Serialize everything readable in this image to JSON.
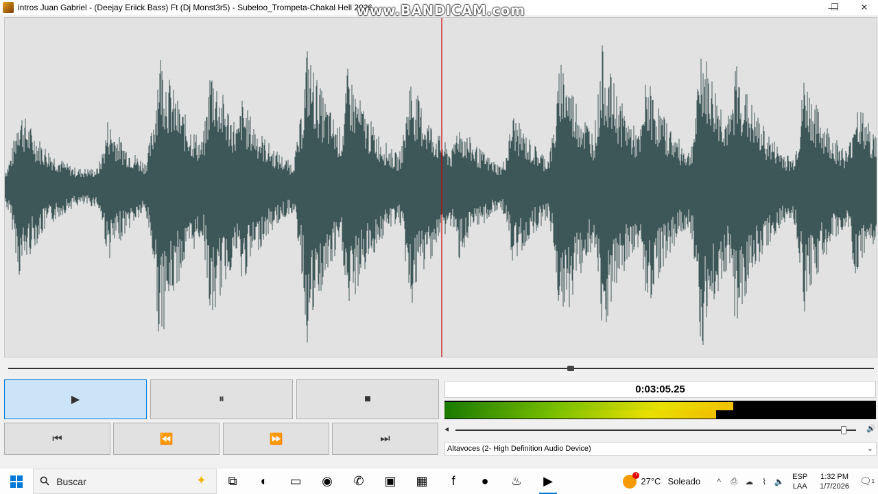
{
  "window": {
    "title": "intros Juan Gabriel - (Deejay Eriick Bass) Ft (Dj Monst3r5) - Subeloo_Trompeta-Chakal Hell 2026",
    "watermark": "www.BANDICAM.com",
    "minimize": "—",
    "restore": "❐",
    "close": "✕"
  },
  "player": {
    "seek_fraction": 0.65,
    "buttons": {
      "play": "▶",
      "pause": "⏸",
      "stop": "■",
      "prev": "⏮",
      "rewind": "⏪",
      "forward": "⏩",
      "next": "⏭"
    },
    "time": "0:03:05.25",
    "meter_left_fraction": 0.67,
    "meter_right_fraction": 0.63,
    "volume_fraction": 0.97,
    "vol_low_icon": "◂",
    "vol_high_icon": "🔊",
    "device": "Altavoces (2- High Definition Audio Device)",
    "device_chevron": "⌄"
  },
  "colors": {
    "waveform": "#3d5657",
    "playhead": "#cc0000",
    "wave_bg": "#e2e2e2"
  },
  "taskbar": {
    "search_placeholder": "Buscar",
    "search_icon": "⚲",
    "deco_icon": "✦",
    "apps": [
      {
        "name": "task-view-icon",
        "glyph": "⧉"
      },
      {
        "name": "edge-icon",
        "glyph": "◐"
      },
      {
        "name": "folder-icon",
        "glyph": "▭"
      },
      {
        "name": "red-app-icon",
        "glyph": "◉"
      },
      {
        "name": "whatsapp-icon",
        "glyph": "✆"
      },
      {
        "name": "dark-app-icon",
        "glyph": "▣"
      },
      {
        "name": "green-app-icon",
        "glyph": "▦"
      },
      {
        "name": "facebook-icon",
        "glyph": "f"
      },
      {
        "name": "bandicam-record-icon",
        "glyph": "●"
      },
      {
        "name": "fl-studio-icon",
        "glyph": "♨"
      },
      {
        "name": "player-app-icon",
        "glyph": "▶"
      }
    ],
    "weather": {
      "temp": "27°C",
      "condition": "Soleado",
      "badge": "7"
    },
    "tray_icons": [
      "^",
      "⎙",
      "☁",
      "⌇",
      "🔈"
    ],
    "lang_top": "ESP",
    "lang_bottom": "LAA",
    "time": "1:32 PM",
    "date": "1/7/2026",
    "notif_icon": "🗨",
    "notif_count": "1"
  }
}
